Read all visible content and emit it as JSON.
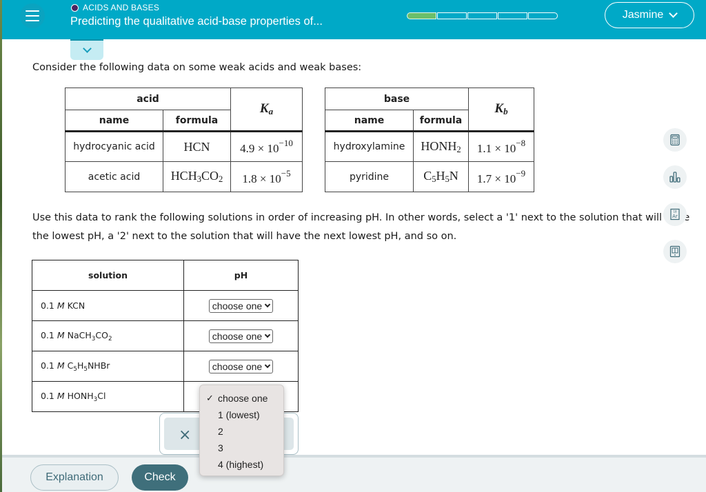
{
  "header": {
    "topic": "ACIDS AND BASES",
    "title": "Predicting the qualitative acid-base properties of...",
    "progress": {
      "segments_total": 5,
      "segments_completed": 1
    },
    "user_name": "Jasmine"
  },
  "intro_text": "Consider the following data on some weak acids and weak bases:",
  "acid_table": {
    "group_header": "acid",
    "name_header": "name",
    "formula_header": "formula",
    "k_symbol": "K",
    "k_subscript": "a",
    "rows": [
      {
        "name": "hydrocyanic acid",
        "formula_parts": [
          "HCN"
        ],
        "k_mantissa": "4.9 × 10",
        "k_exponent": "−10"
      },
      {
        "name": "acetic acid",
        "formula_parts": [
          "HCH",
          "3",
          "CO",
          "2"
        ],
        "k_mantissa": "1.8 × 10",
        "k_exponent": "−5"
      }
    ]
  },
  "base_table": {
    "group_header": "base",
    "name_header": "name",
    "formula_header": "formula",
    "k_symbol": "K",
    "k_subscript": "b",
    "rows": [
      {
        "name": "hydroxylamine",
        "formula_parts": [
          "HONH",
          "2"
        ],
        "k_mantissa": "1.1 × 10",
        "k_exponent": "−8"
      },
      {
        "name": "pyridine",
        "formula_parts": [
          "C",
          "5",
          "H",
          "5",
          "N"
        ],
        "k_mantissa": "1.7 × 10",
        "k_exponent": "−9"
      }
    ]
  },
  "instructions": "Use this data to rank the following solutions in order of increasing pH. In other words, select a '1' next to the solution that will have the lowest pH, a '2' next to the solution that will have the next lowest pH, and so on.",
  "tools": [
    "calculator-icon",
    "chart-icon",
    "periodic-table-icon",
    "reference-book-icon"
  ],
  "solution_table": {
    "solution_header": "solution",
    "ph_header": "pH",
    "rows": [
      {
        "conc": "0.1",
        "unit": "M",
        "formula_parts": [
          "KCN"
        ],
        "selected": "choose one"
      },
      {
        "conc": "0.1",
        "unit": "M",
        "formula_parts": [
          "NaCH",
          "3",
          "CO",
          "2"
        ],
        "selected": "choose one"
      },
      {
        "conc": "0.1",
        "unit": "M",
        "formula_parts": [
          "C",
          "5",
          "H",
          "5",
          "NHBr"
        ],
        "selected": "choose one"
      },
      {
        "conc": "0.1",
        "unit": "M",
        "formula_parts": [
          "HONH",
          "3",
          "Cl"
        ],
        "selected": "choose one"
      }
    ]
  },
  "dropdown": {
    "options": [
      "choose one",
      "1 (lowest)",
      "2",
      "3",
      "4 (highest)"
    ],
    "checked_index": 0,
    "check_mark": "✓"
  },
  "action_box": {
    "close_symbol": "×"
  },
  "footer": {
    "explanation_label": "Explanation",
    "check_label": "Check"
  }
}
